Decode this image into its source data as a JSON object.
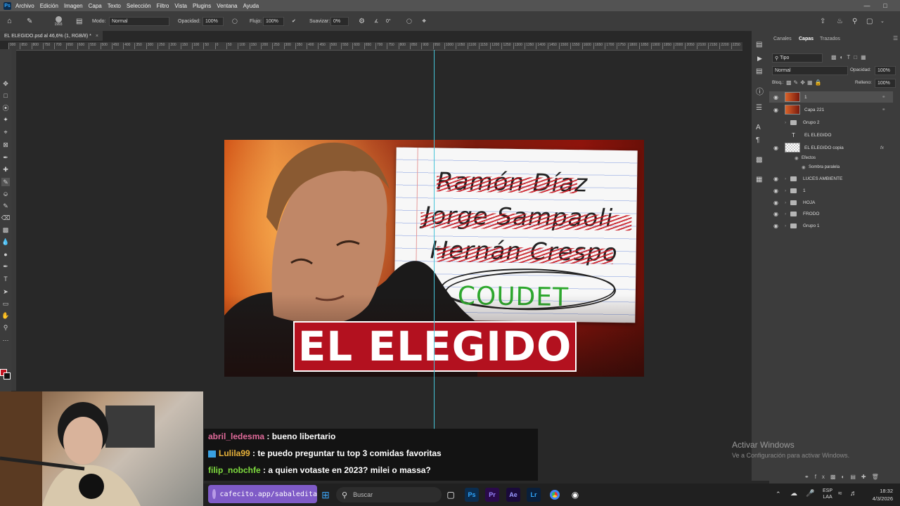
{
  "menubar": {
    "logo": "Ps",
    "items": [
      "Archivo",
      "Edición",
      "Imagen",
      "Capa",
      "Texto",
      "Selección",
      "Filtro",
      "Vista",
      "Plugins",
      "Ventana",
      "Ayuda"
    ]
  },
  "options": {
    "brush_size": "1993",
    "mode_label": "Modo:",
    "mode_value": "Normal",
    "opacity_label": "Opacidad:",
    "opacity_value": "100%",
    "flow_label": "Flujo:",
    "flow_value": "100%",
    "smooth_label": "Suavizar:",
    "smooth_value": "0%",
    "angle_value": "0°"
  },
  "document": {
    "tab_title": "EL ELEGIDO.psd al 46,6% (1, RGB/8) *",
    "close": "×"
  },
  "ruler_ticks": [
    "900",
    "850",
    "800",
    "750",
    "700",
    "650",
    "600",
    "550",
    "500",
    "450",
    "400",
    "350",
    "300",
    "250",
    "200",
    "150",
    "100",
    "50",
    "0",
    "50",
    "100",
    "150",
    "200",
    "250",
    "300",
    "350",
    "400",
    "450",
    "500",
    "550",
    "600",
    "650",
    "700",
    "750",
    "800",
    "850",
    "900",
    "950",
    "1000",
    "1050",
    "1100",
    "1150",
    "1200",
    "1250",
    "1300",
    "1350",
    "1400",
    "1450",
    "1500",
    "1550",
    "1600",
    "1650",
    "1700",
    "1750",
    "1800",
    "1850",
    "1900",
    "1950",
    "2000",
    "2050",
    "2100",
    "2150",
    "2200",
    "2250"
  ],
  "thumbnail": {
    "names": [
      "Ramón Díaz",
      "Jorge Sampaoli",
      "Hernán Crespo"
    ],
    "chosen": "COUDET",
    "title": "EL ELEGIDO"
  },
  "layers_panel": {
    "tabs": [
      "Canales",
      "Capas",
      "Trazados"
    ],
    "filter": "Tipo",
    "blend": "Normal",
    "opacity_label": "Opacidad:",
    "opacity_value": "100%",
    "lock_label": "Bloq.:",
    "fill_label": "Relleno:",
    "fill_value": "100%",
    "layers": [
      {
        "name": "1",
        "kind": "thumb"
      },
      {
        "name": "Capa 221",
        "kind": "thumb"
      },
      {
        "name": "Grupo 2",
        "kind": "folder"
      },
      {
        "name": "EL ELEGIDO",
        "kind": "text"
      },
      {
        "name": "EL ELEGIDO copia",
        "kind": "thumb"
      },
      {
        "name": "Efectos",
        "kind": "effect"
      },
      {
        "name": "Sombra paralela",
        "kind": "effect"
      },
      {
        "name": "LUCES AMBIENTE",
        "kind": "folder"
      },
      {
        "name": "1",
        "kind": "folder"
      },
      {
        "name": "HOJA",
        "kind": "folder"
      },
      {
        "name": "FRODO",
        "kind": "folder"
      },
      {
        "name": "Grupo 1",
        "kind": "folder"
      }
    ],
    "fx": "fx"
  },
  "chat": [
    {
      "user": "abril_ledesma",
      "user_color": "#e06a9a",
      "text": " : bueno libertario"
    },
    {
      "user": "Lulila99",
      "user_color": "#e8b23a",
      "text": " : te puedo preguntar tu top 3 comidas favoritas"
    },
    {
      "user": "filip_nobchfe",
      "user_color": "#7fdc3f",
      "text": " : a quien votaste en 2023? milei o massa?"
    }
  ],
  "windows_activation": {
    "line1": "Activar Windows",
    "line2": "Ve a Configuración para activar Windows."
  },
  "taskbar": {
    "cafecito": "cafecito.app/sabaledita",
    "search_placeholder": "Buscar",
    "lang1": "ESP",
    "lang2": "LAA",
    "time": "18:32",
    "date": "4/3/2026",
    "apps": [
      "Ps",
      "Pr",
      "Ae",
      "Lr"
    ]
  }
}
